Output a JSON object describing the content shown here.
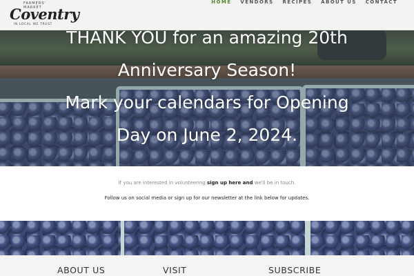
{
  "logo": {
    "top_text": "FARMERS' MARKET",
    "name": "Coventry",
    "tagline": "IN LOCAL WE TRUST"
  },
  "nav": {
    "items": [
      {
        "label": "HOME",
        "active": true
      },
      {
        "label": "VENDORS",
        "active": false
      },
      {
        "label": "RECIPES",
        "active": false
      },
      {
        "label": "ABOUT US",
        "active": false
      },
      {
        "label": "CONTACT",
        "active": false
      }
    ]
  },
  "hero": {
    "line1": "THANK YOU for an amazing 20th",
    "line2": "Anniversary Season!",
    "line3": "Mark your calendars for Opening",
    "line4": "Day on June 2, 2024."
  },
  "info": {
    "volunteer_prefix": "If you are interested in volunteering",
    "volunteer_link": "sign up here and",
    "volunteer_suffix": "we'll be in touch.",
    "follow_text": "Follow us on social media or sign up for our newsletter at the link below for updates."
  },
  "footer": {
    "col1": "ABOUT US",
    "col2": "VISIT",
    "col3": "SUBSCRIBE"
  },
  "colors": {
    "accent_green": "#4f8a2e",
    "header_bg": "#f3f3f1"
  }
}
